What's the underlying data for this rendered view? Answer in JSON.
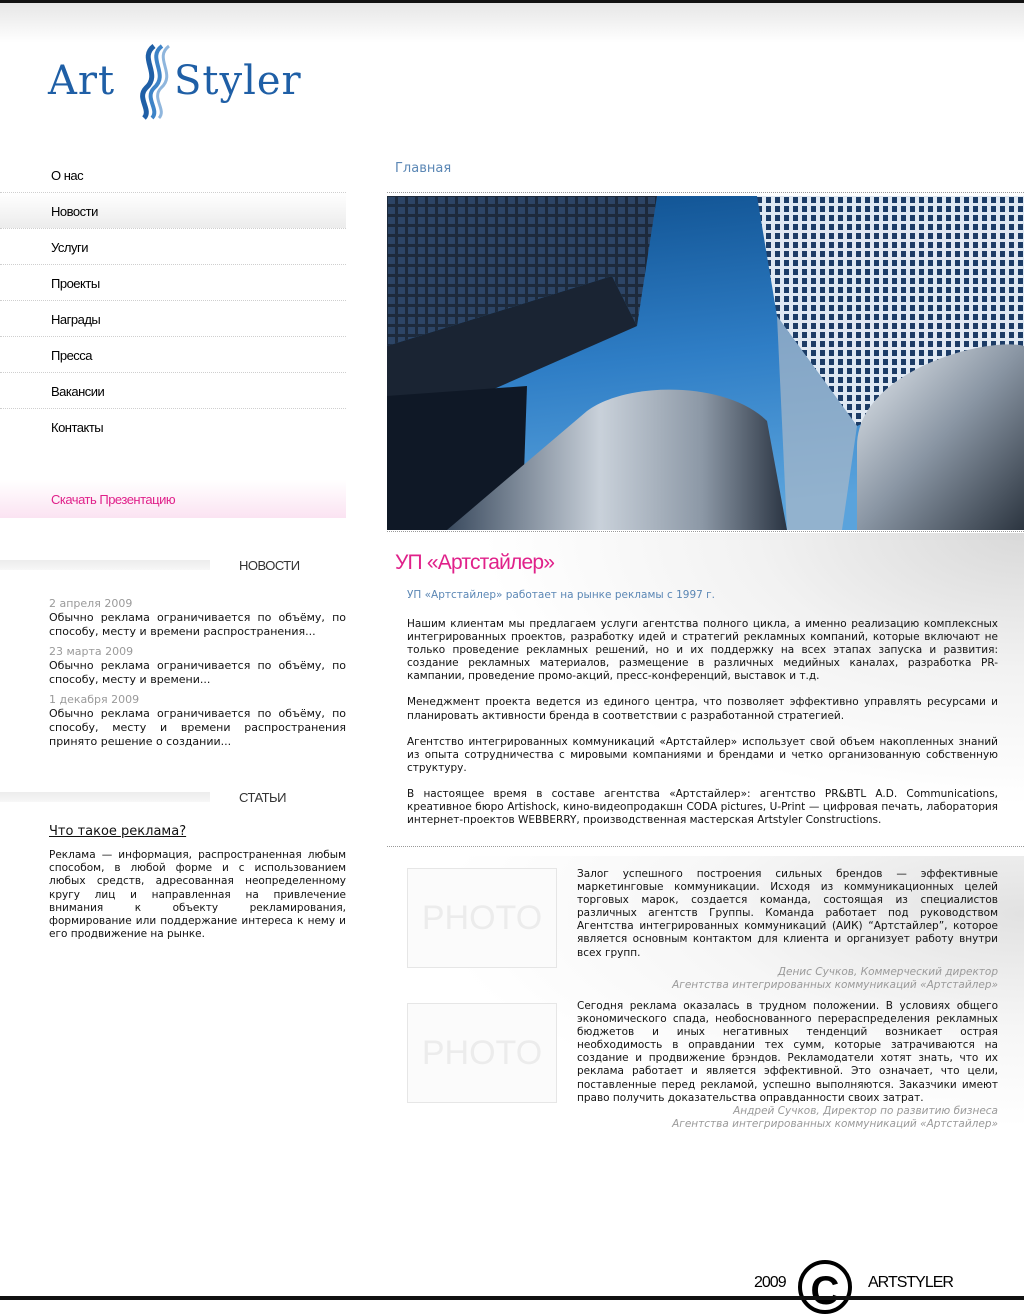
{
  "logo": {
    "left_word": "Art",
    "right_word": "Styler"
  },
  "nav": {
    "items": [
      {
        "label": "О нас"
      },
      {
        "label": "Новости"
      },
      {
        "label": "Услуги"
      },
      {
        "label": "Проекты"
      },
      {
        "label": "Награды"
      },
      {
        "label": "Пресса"
      },
      {
        "label": "Вакансии"
      },
      {
        "label": "Контакты"
      }
    ],
    "active_index": 1,
    "download_label": "Скачать Презентацию"
  },
  "news": {
    "title": "НОВОСТИ",
    "items": [
      {
        "date": "2 апреля 2009",
        "text": "Обычно реклама ограничивается по объёму, по способу, месту и времени распространения..."
      },
      {
        "date": "23 марта 2009",
        "text": "Обычно реклама ограничивается по объёму, по способу, месту и времени..."
      },
      {
        "date": "1 декабря 2009",
        "text": "Обычно реклама ограничивается по объёму, по способу, месту и времени распространения принято решение о создании..."
      }
    ]
  },
  "articles": {
    "title": "СТАТЬИ",
    "item_title": "Что такое реклама?",
    "item_text": "Реклама — информация, распространенная любым способом, в любой форме и с использованием любых средств, адресованная неопределенному кругу лиц и направленная на привлечение внимания к объекту рекламирования, формирование или поддержание интереса к нему и его продвижение на рынке."
  },
  "breadcrumb": "Главная",
  "main": {
    "title": "УП «Артстайлер»",
    "subtitle": "УП «Артстайлер» работает на рынке рекламы с 1997 г.",
    "paragraphs": [
      "Нашим клиентам мы предлагаем услуги агентства полного цикла, а именно реализацию комплексных интегрированных проектов, разработку идей и стратегий рекламных компаний, которые включают не только проведение рекламных решений, но и их поддержку на всех этапах запуска и развития: создание рекламных материалов, размещение в различных медийных каналах, разработка PR-кампании, проведение промо-акций, пресс-конференций, выставок и т.д.",
      "Менеджмент проекта ведется из единого центра, что позволяет эффективно управлять ресурсами и планировать активности бренда в соответствии с разработанной стратегией.",
      "Агентство интегрированных коммуникаций «Артстайлер» использует свой объем накопленных знаний из опыта сотрудничества с мировыми компаниями и брендами и четко организованную собственную структуру.",
      "В настоящее время в составе агентства «Артстайлер»: агентство PR&BTL A.D. Communications, креативное бюро Artishock, кино-видеопродакшн CODA pictures, U-Print — цифровая печать, лаборатория интернет-проектов WEBBERRY, производственная мастерская Artstyler Constructions."
    ]
  },
  "quotes": [
    {
      "photo_label": "PHOTO",
      "text": "Залог успешного построения сильных брендов — эффективные маркетинговые коммуникации. Исходя из коммуникационных целей торговых марок, создается команда, состоящая из специалистов различных агентств Группы. Команда работает под руководством Агентства интегрированных коммуникаций (АИК) “Артстайлер”, которое является основным контактом для клиента и организует работу внутри всех групп.",
      "author": "Денис Сучков, Коммерческий директор",
      "company": "Агентства интегрированных коммуникаций «Артстайлер»"
    },
    {
      "photo_label": "PHOTO",
      "text": "Сегодня реклама оказалась в трудном положении. В условиях общего экономического спада, необоснованного перераспределения рекламных бюджетов и иных негативных тенденций возникает острая необходимость в оправдании тех сумм, которые затрачиваются на создание и продвижение брэндов. Рекламодатели хотят знать, что их реклама работает и является эффективной. Это означает, что цели, поставленные перед рекламой, успешно выполняются. Заказчики имеют право получить доказательства оправданности своих затрат.",
      "author": "Андрей Сучков, Директор по развитию бизнеса",
      "company": "Агентства интегрированных коммуникаций «Артстайлер»"
    }
  ],
  "footer": {
    "year": "2009",
    "copyright_symbol": "C",
    "name": "ARTSTYLER"
  },
  "colors": {
    "brand_blue": "#1f5fa6",
    "accent_pink": "#e0218a",
    "link_blue": "#5b87b5"
  }
}
